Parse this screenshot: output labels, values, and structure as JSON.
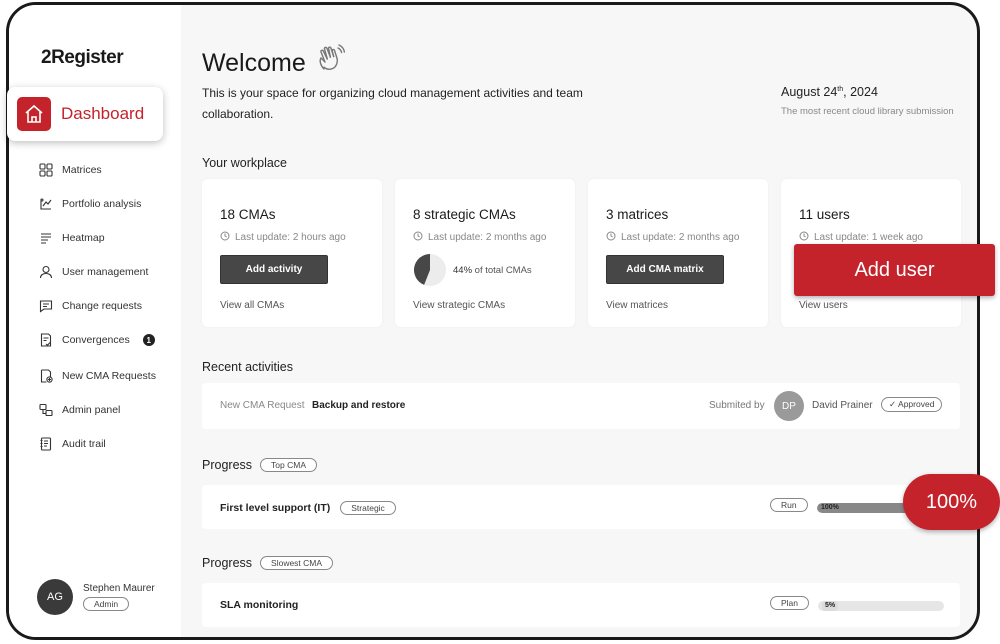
{
  "app": {
    "logo": "2Register"
  },
  "sidebar": {
    "dashboard_label": "Dashboard",
    "items": [
      {
        "label": "Matrices",
        "icon": "grid-icon"
      },
      {
        "label": "Portfolio analysis",
        "icon": "portfolio-analysis-icon"
      },
      {
        "label": "Heatmap",
        "icon": "heatmap-icon"
      },
      {
        "label": "User management",
        "icon": "user-icon"
      },
      {
        "label": "Change requests",
        "icon": "chat-icon"
      },
      {
        "label": "Convergences",
        "icon": "document-check-icon",
        "badge": "1"
      },
      {
        "label": "New CMA Requests",
        "icon": "document-add-icon"
      },
      {
        "label": "Admin panel",
        "icon": "admin-panel-icon"
      },
      {
        "label": "Audit trail",
        "icon": "notebook-icon"
      }
    ],
    "user": {
      "initials": "AG",
      "name": "Stephen Maurer",
      "role": "Admin"
    }
  },
  "header": {
    "title": "Welcome",
    "intro": "This is your space for organizing cloud management activities and team collaboration.",
    "date_main": "August 24",
    "date_suffix": "th",
    "date_year": ", 2024",
    "date_caption": "The most recent cloud library submission"
  },
  "workplace": {
    "title": "Your workplace",
    "cards": [
      {
        "title": "18 CMAs",
        "update": "Last update: 2 hours ago",
        "button": "Add activity",
        "link": "View all CMAs"
      },
      {
        "title": "8 strategic CMAs",
        "update": "Last update: 2 months ago",
        "percent": "44%",
        "percent_caption": "of total CMAs",
        "percent_value": 44,
        "link": "View strategic CMAs"
      },
      {
        "title": "3 matrices",
        "update": "Last update: 2 months ago",
        "button": "Add CMA matrix",
        "link": "View matrices"
      },
      {
        "title": "11 users",
        "update": "Last update: 1 week ago",
        "button": "Add user",
        "link": "View users"
      }
    ]
  },
  "recent": {
    "title": "Recent activities",
    "item": {
      "type": "New CMA Request",
      "name": "Backup and restore",
      "submitted_label": "Submited by",
      "initials": "DP",
      "user": "David Prainer",
      "status": "Approved"
    }
  },
  "progress_top": {
    "title": "Progress",
    "tag": "Top CMA",
    "item": {
      "name": "First level support (IT)",
      "category": "Strategic",
      "status": "Run",
      "percent_label": "100%",
      "percent_value": 100
    }
  },
  "progress_slow": {
    "title": "Progress",
    "tag": "Slowest CMA",
    "item": {
      "name": "SLA monitoring",
      "status": "Plan",
      "percent_label": "5%",
      "percent_value": 5
    }
  },
  "callouts": {
    "add_user": "Add user",
    "percent": "100%"
  },
  "colors": {
    "accent": "#c4232c",
    "button_dark": "#474747"
  }
}
